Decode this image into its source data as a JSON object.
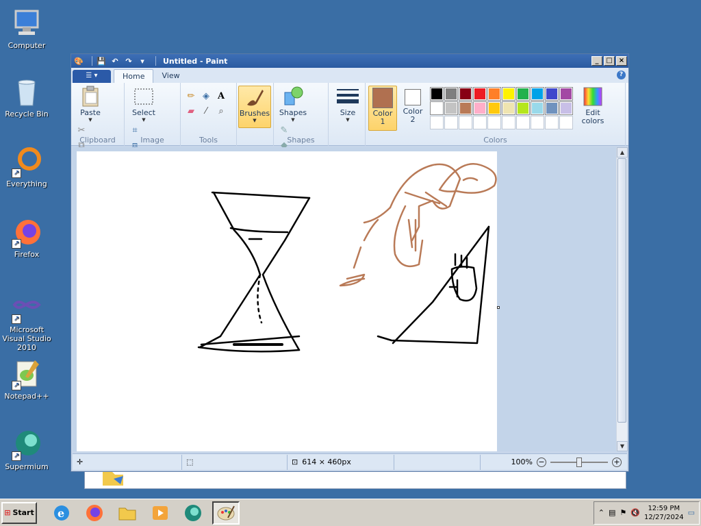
{
  "desktop": {
    "icons": [
      {
        "label": "Computer"
      },
      {
        "label": "Recycle Bin"
      },
      {
        "label": "Everything"
      },
      {
        "label": "Firefox"
      },
      {
        "label": "Microsoft Visual Studio 2010"
      },
      {
        "label": "Notepad++"
      },
      {
        "label": "Supermium"
      }
    ]
  },
  "window": {
    "title": "Untitled - Paint",
    "tabs": [
      "Home",
      "View"
    ],
    "help": "?",
    "ribbon": {
      "clipboard": {
        "paste_label": "Paste",
        "group_label": "Clipboard"
      },
      "image": {
        "select_label": "Select",
        "group_label": "Image"
      },
      "tools": {
        "group_label": "Tools"
      },
      "brushes": {
        "label": "Brushes"
      },
      "shapes": {
        "label": "Shapes",
        "group_label": "Shapes"
      },
      "size": {
        "label": "Size"
      },
      "color1": {
        "label": "Color 1",
        "value": "#b07050"
      },
      "color2": {
        "label": "Color 2",
        "value": "#ffffff"
      },
      "edit_colors": {
        "label": "Edit colors"
      },
      "colors_group_label": "Colors",
      "palette_row1": [
        "#000000",
        "#7f7f7f",
        "#880015",
        "#ed1c24",
        "#ff7f27",
        "#fff200",
        "#22b14c",
        "#00a2e8",
        "#3f48cc",
        "#a349a4"
      ],
      "palette_row2": [
        "#ffffff",
        "#c3c3c3",
        "#b97a57",
        "#ffaec9",
        "#ffc90e",
        "#efe4b0",
        "#b5e61d",
        "#99d9ea",
        "#7092be",
        "#c8bfe7"
      ],
      "palette_row3": [
        "#ffffff",
        "#ffffff",
        "#ffffff",
        "#ffffff",
        "#ffffff",
        "#ffffff",
        "#ffffff",
        "#ffffff",
        "#ffffff",
        "#ffffff"
      ]
    },
    "status": {
      "canvas_size": "614 × 460px",
      "zoom": "100%"
    }
  },
  "taskbar": {
    "start_label": "Start",
    "clock_time": "12:59 PM",
    "clock_date": "12/27/2024"
  }
}
